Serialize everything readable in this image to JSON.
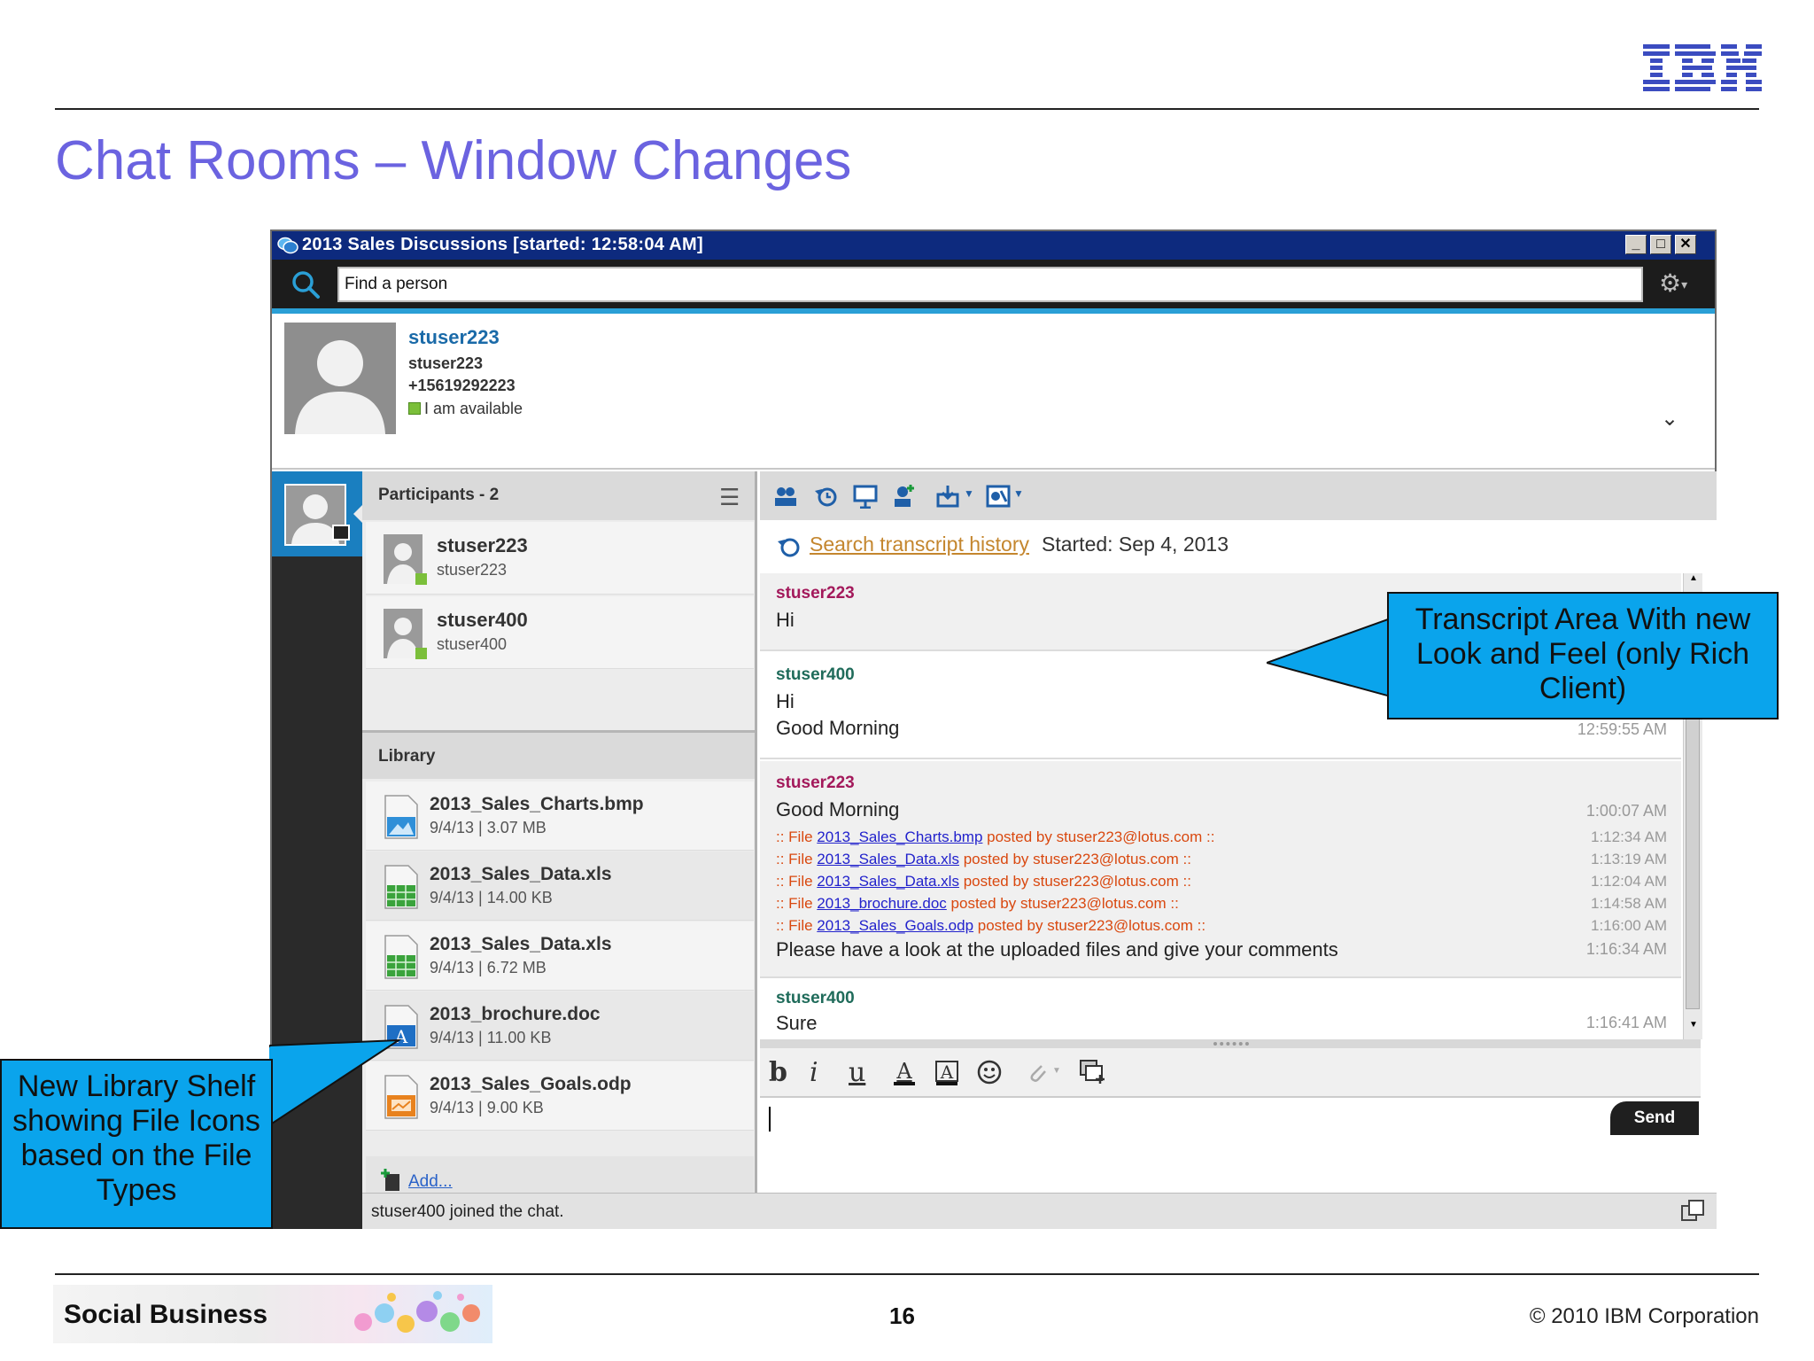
{
  "slide": {
    "title": "Chat Rooms – Window Changes",
    "footer_badge": "Social Business",
    "page_number": "16",
    "copyright": "© 2010 IBM Corporation",
    "logo": "IBM"
  },
  "window": {
    "title": "2013 Sales Discussions [started: 12:58:04 AM]",
    "controls": [
      "minimize",
      "maximize",
      "close"
    ],
    "search_placeholder": "Find a person",
    "accent_color": "#2a9fd6",
    "titlebar_color": "#0d2a7e"
  },
  "profile": {
    "name": "stuser223",
    "username": "stuser223",
    "phone": "+15619292223",
    "status": "I am available",
    "status_color": "#7bbf3a"
  },
  "participants": {
    "header": "Participants - 2",
    "items": [
      {
        "name": "stuser223",
        "sub": "stuser223"
      },
      {
        "name": "stuser400",
        "sub": "stuser400"
      }
    ]
  },
  "library": {
    "header": "Library",
    "files": [
      {
        "name": "2013_Sales_Charts.bmp",
        "meta": "9/4/13 | 3.07 MB",
        "icon": "image-file-icon"
      },
      {
        "name": "2013_Sales_Data.xls",
        "meta": "9/4/13 | 14.00 KB",
        "icon": "spreadsheet-file-icon"
      },
      {
        "name": "2013_Sales_Data.xls",
        "meta": "9/4/13 | 6.72 MB",
        "icon": "spreadsheet-file-icon"
      },
      {
        "name": "2013_brochure.doc",
        "meta": "9/4/13 | 11.00 KB",
        "icon": "document-file-icon"
      },
      {
        "name": "2013_Sales_Goals.odp",
        "meta": "9/4/13 | 9.00 KB",
        "icon": "presentation-file-icon"
      }
    ],
    "add_label": "Add..."
  },
  "transcript": {
    "search_link": "Search transcript history",
    "started": "Started: Sep 4, 2013",
    "messages": [
      {
        "sender": "stuser223",
        "lines": [
          "Hi"
        ],
        "time": ""
      },
      {
        "sender": "stuser400",
        "lines": [
          "Hi",
          "Good Morning"
        ],
        "time": "12:59:55 AM"
      },
      {
        "sender": "stuser223",
        "first": "Good Morning",
        "first_time": "1:00:07 AM",
        "files": [
          {
            "pre": ":: File ",
            "link": "2013_Sales_Charts.bmp",
            "post": " posted by stuser223@lotus.com ::",
            "time": "1:12:34 AM"
          },
          {
            "pre": ":: File ",
            "link": "2013_Sales_Data.xls",
            "post": " posted by stuser223@lotus.com ::",
            "time": "1:13:19 AM"
          },
          {
            "pre": ":: File ",
            "link": "2013_Sales_Data.xls",
            "post": " posted by stuser223@lotus.com ::",
            "time": "1:12:04 AM"
          },
          {
            "pre": ":: File ",
            "link": "2013_brochure.doc",
            "post": " posted by stuser223@lotus.com ::",
            "time": "1:14:58 AM"
          },
          {
            "pre": ":: File ",
            "link": "2013_Sales_Goals.odp",
            "post": " posted by stuser223@lotus.com ::",
            "time": "1:16:00 AM"
          }
        ],
        "last": "Please have a look at the uploaded files and give your comments",
        "last_time": "1:16:34 AM"
      },
      {
        "sender": "stuser400",
        "lines": [
          "Sure"
        ],
        "time": "1:16:41 AM"
      }
    ],
    "sender_colors": {
      "stuser223": "#a3195b",
      "stuser400": "#1f6b5a"
    }
  },
  "compose": {
    "send_label": "Send",
    "format_buttons": [
      "b",
      "i",
      "u"
    ]
  },
  "status_bar": "stuser400 joined the chat.",
  "callouts": {
    "transcript": "Transcript Area With new Look and Feel (only Rich Client)",
    "library": "New Library Shelf showing File Icons based on the File Types",
    "fill_color": "#0aa4ec"
  }
}
